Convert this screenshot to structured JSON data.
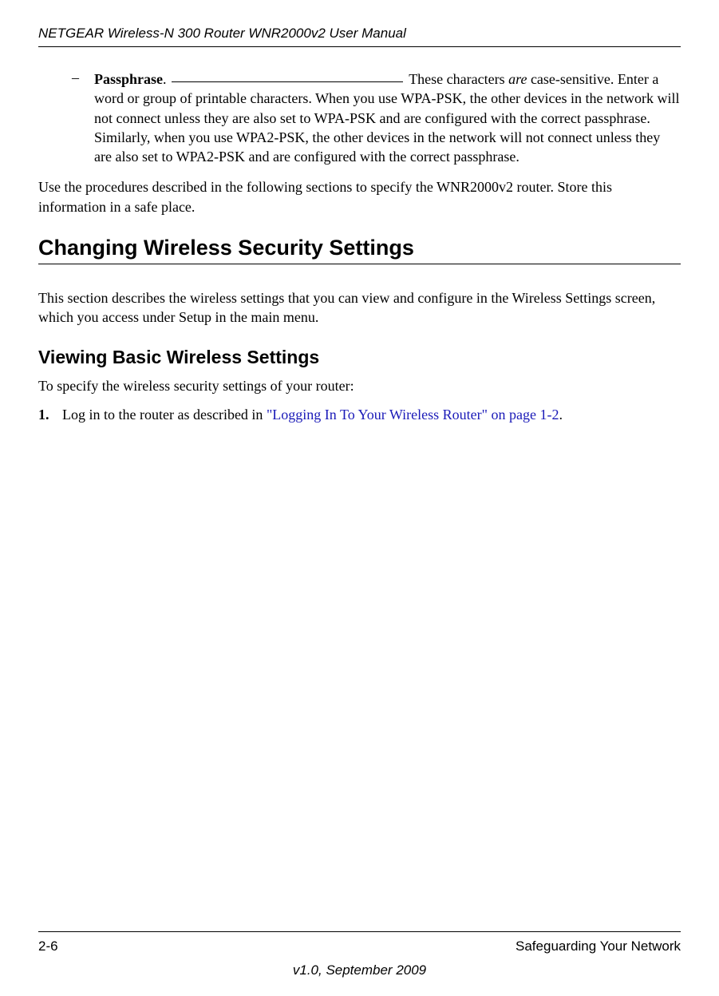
{
  "header": {
    "title": "NETGEAR Wireless-N 300 Router WNR2000v2 User Manual"
  },
  "bullet": {
    "label": "Passphrase",
    "after_blank": " These characters ",
    "are": "are",
    "rest": " case-sensitive. Enter a word or group of printable characters. When you use WPA-PSK, the other devices in the network will not connect unless they are also set to WPA-PSK and are configured with the correct passphrase. Similarly, when you use WPA2-PSK, the other devices in the network will not connect unless they are also set to WPA2-PSK and are configured with the correct passphrase."
  },
  "para1": "Use the procedures described in the following sections to specify the WNR2000v2 router. Store this information in a safe place.",
  "h1": "Changing Wireless Security Settings",
  "intro": "This section describes the wireless settings that you can view and configure in the Wireless Settings screen, which you access under Setup in the main menu.",
  "h2": "Viewing Basic Wireless Settings",
  "sub": "To specify the wireless security settings of your router:",
  "step1": {
    "num": "1.",
    "text": "Log in to the router as described in ",
    "link": "\"Logging In To Your Wireless Router\" on page 1-2",
    "end": "."
  },
  "footer": {
    "page": "2-6",
    "section": "Safeguarding Your Network",
    "version": "v1.0, September 2009"
  }
}
